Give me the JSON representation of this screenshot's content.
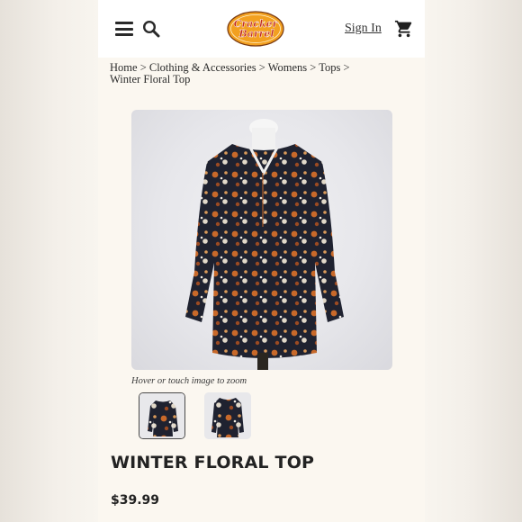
{
  "header": {
    "menu_icon": "hamburger-menu-icon",
    "search_icon": "search-icon",
    "logo_text": "Cracker Barrel",
    "sign_in_label": "Sign In",
    "cart_icon": "shopping-cart-icon"
  },
  "breadcrumb": {
    "items": [
      "Home",
      "Clothing & Accessories",
      "Womens",
      "Tops",
      "Winter Floral Top"
    ],
    "separator": ">"
  },
  "product": {
    "zoom_hint": "Hover or touch image to zoom",
    "thumbnail_count": 2,
    "title": "WINTER FLORAL TOP",
    "price": "$39.99"
  },
  "colors": {
    "page_background": "#fbf7f0",
    "logo_orange": "#f2a020",
    "logo_red": "#c0281c",
    "text": "#222222"
  }
}
